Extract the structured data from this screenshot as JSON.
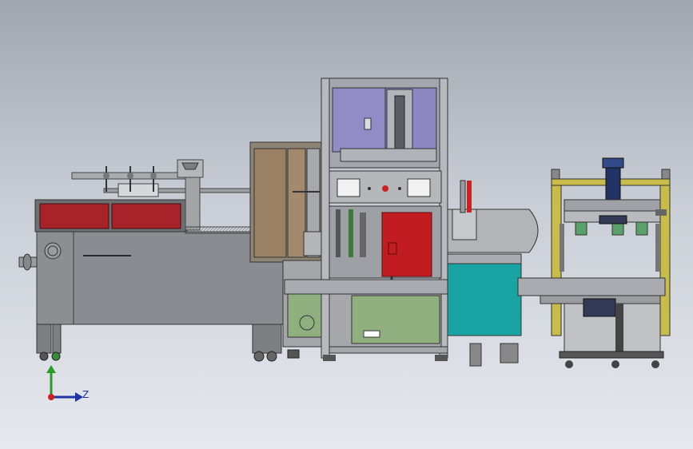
{
  "triad": {
    "z_label": "Z"
  },
  "machines": [
    "packing-machine",
    "case-erector",
    "control-tower",
    "case-sealer"
  ],
  "colors": {
    "background_top": "#9fa6af",
    "background_bottom": "#e6e9ee",
    "frame_gray": "#8a8c92",
    "red_panel": "#a8222a",
    "teal_cabinet": "#1aa3a3",
    "green_panel": "#8fb07e",
    "purple_glass": "#8c86c2",
    "yellow_rail": "#c8bd4a",
    "navy_motor": "#223366"
  }
}
